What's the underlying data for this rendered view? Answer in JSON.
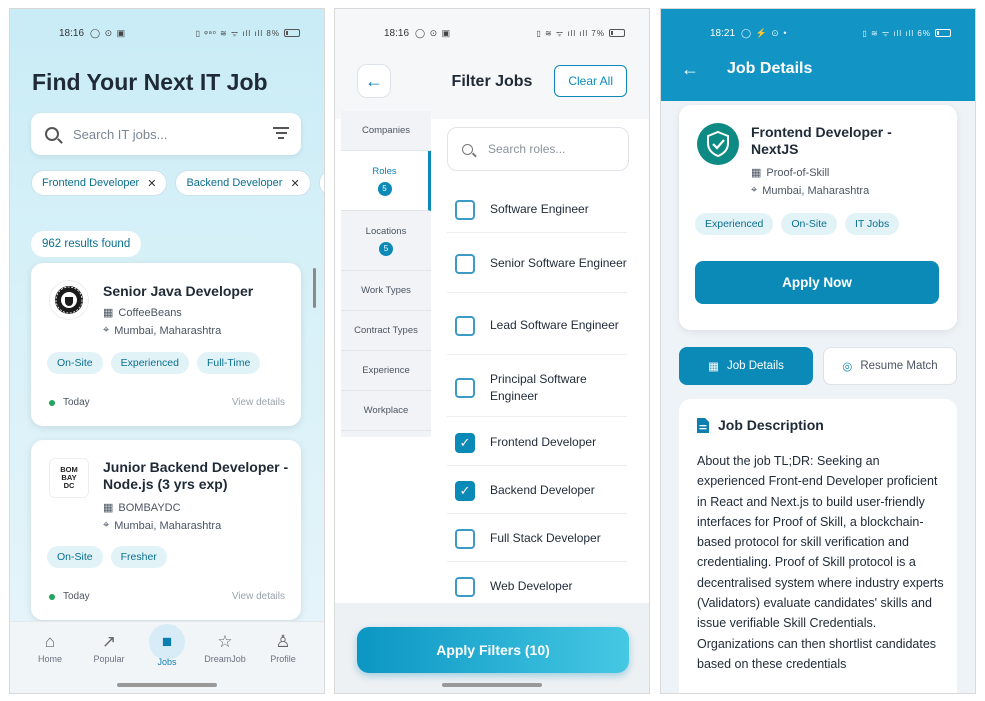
{
  "panel1": {
    "status_time": "18:16",
    "status_icons": "◯ ⊙ ▣",
    "status_right": "▯ ᵠᵃᵒ ≋ ᯤ ıll ıll 8%",
    "title": "Find Your Next IT Job",
    "search_placeholder": "Search IT jobs...",
    "chips": [
      "Frontend Developer",
      "Backend Developer"
    ],
    "chip_close": "✕",
    "results": "962 results found",
    "jobs": [
      {
        "title": "Senior Java Developer",
        "company": "CoffeeBeans",
        "location": "Mumbai, Maharashtra",
        "tags": [
          "On-Site",
          "Experienced",
          "Full-Time"
        ],
        "posted": "Today",
        "link": "View details"
      },
      {
        "title": "Junior Backend Developer - Node.js (3 yrs exp)",
        "company": "BOMBAYDC",
        "location": "Mumbai, Maharashtra",
        "tags": [
          "On-Site",
          "Fresher"
        ],
        "posted": "Today",
        "link": "View details"
      }
    ],
    "nav": [
      "Home",
      "Popular",
      "Jobs",
      "DreamJob",
      "Profile"
    ]
  },
  "panel2": {
    "status_time": "18:16",
    "status_icons": "◯ ⊙ ▣",
    "status_right": "▯ ≋ ᯤ ıll ıll 7%",
    "title": "Filter Jobs",
    "clear_label": "Clear All",
    "sidebar": [
      {
        "label": "Companies",
        "badge": ""
      },
      {
        "label": "Roles",
        "badge": "5"
      },
      {
        "label": "Locations",
        "badge": "5"
      },
      {
        "label": "Work Types",
        "badge": ""
      },
      {
        "label": "Contract Types",
        "badge": ""
      },
      {
        "label": "Experience",
        "badge": ""
      },
      {
        "label": "Workplace",
        "badge": ""
      }
    ],
    "search_placeholder": "Search roles...",
    "roles": [
      {
        "label": "Software Engineer",
        "checked": false
      },
      {
        "label": "Senior Software Engineer",
        "checked": false
      },
      {
        "label": "Lead Software Engineer",
        "checked": false
      },
      {
        "label": "Principal Software Engineer",
        "checked": false
      },
      {
        "label": "Frontend Developer",
        "checked": true
      },
      {
        "label": "Backend Developer",
        "checked": true
      },
      {
        "label": "Full Stack Developer",
        "checked": false
      },
      {
        "label": "Web Developer",
        "checked": false
      }
    ],
    "apply_label": "Apply Filters (10)"
  },
  "panel3": {
    "status_time": "18:21",
    "status_icons": "◯ ⚡ ⊙ •",
    "status_right": "▯ ≋ ᯤ ıll ıll 6%",
    "title": "Job Details",
    "job_title": "Frontend Developer - NextJS",
    "company": "Proof-of-Skill",
    "location": "Mumbai, Maharashtra",
    "tags": [
      "Experienced",
      "On-Site",
      "IT Jobs"
    ],
    "apply_label": "Apply Now",
    "tab_details": "Job Details",
    "tab_match": "Resume Match",
    "desc_heading": "Job Description",
    "desc_text": "About the job TL;DR: Seeking an experienced Front-end Developer proficient in React and Next.js to build user-friendly interfaces for Proof of Skill, a blockchain-based protocol for skill verification and credentialing. Proof of Skill protocol is a decentralised system where industry experts (Validators) evaluate candidates' skills and issue verifiable Skill Credentials. Organizations can then shortlist candidates based on these credentials"
  },
  "colors": {
    "accent": "#0b8ab8",
    "header": "#1294c4",
    "tag_bg": "#e2f3f8"
  }
}
